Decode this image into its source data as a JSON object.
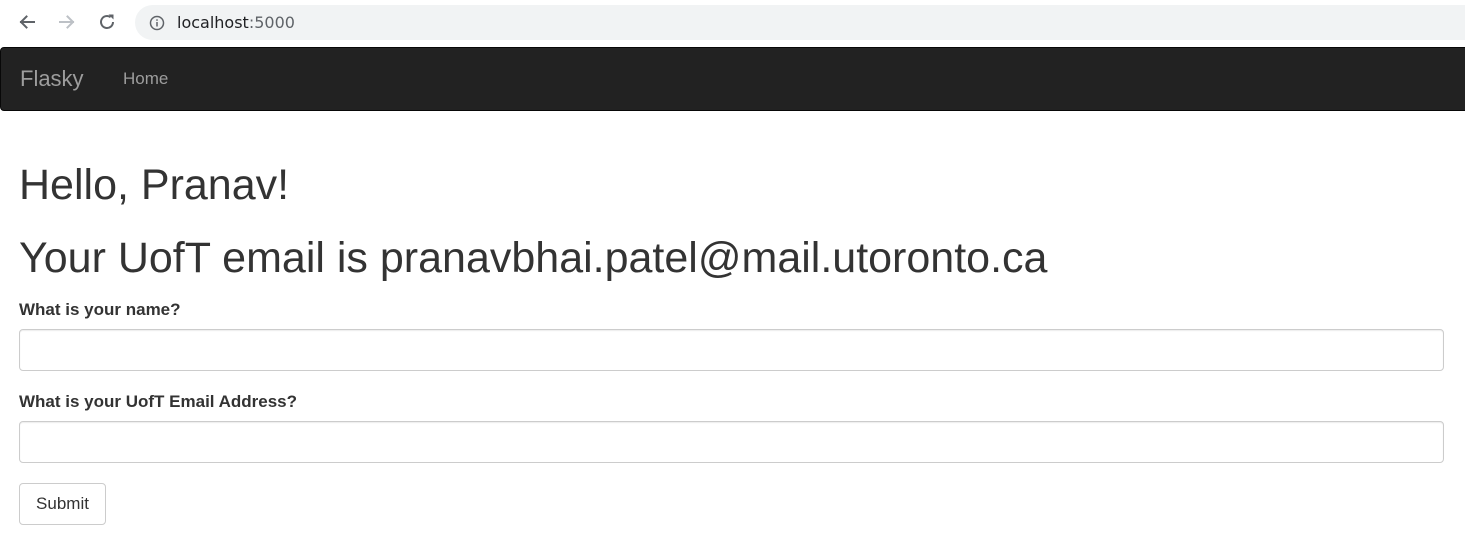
{
  "browser": {
    "url_host": "localhost",
    "url_port": ":5000",
    "icons": {
      "back": "arrow-left-icon",
      "forward": "arrow-right-icon",
      "reload": "reload-icon",
      "info": "info-icon"
    }
  },
  "navbar": {
    "brand": "Flasky",
    "links": [
      {
        "label": "Home"
      }
    ]
  },
  "main": {
    "greeting": "Hello, Pranav!",
    "email_message": "Your UofT email is pranavbhai.patel@mail.utoronto.ca"
  },
  "form": {
    "name_label": "What is your name?",
    "name_value": "",
    "email_label": "What is your UofT Email Address?",
    "email_value": "",
    "submit_label": "Submit"
  },
  "colors": {
    "navbar_bg": "#222222",
    "navbar_text": "#9d9d9d",
    "text": "#333333",
    "address_bar_bg": "#f1f3f4",
    "input_border": "#cccccc"
  }
}
